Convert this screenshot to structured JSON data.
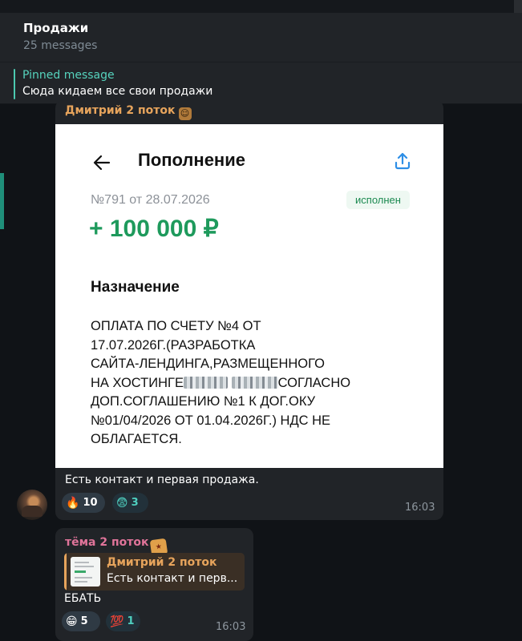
{
  "header": {
    "title": "Продажи",
    "subtitle": "25 messages"
  },
  "pinned": {
    "label": "Pinned message",
    "text": "Сюда кидаем все свои продажи"
  },
  "messages": [
    {
      "sender": "Дмитрий 2 поток",
      "receipt": {
        "title": "Пополнение",
        "number": "№791 от 28.07.2026",
        "status": "исполнен",
        "amount": "+ 100 000 ₽",
        "purpose_heading": "Назначение",
        "purpose_lines": [
          "ОПЛАТА ПО СЧЕТУ №4 ОТ",
          "17.07.2026Г.(РАЗРАБОТКА",
          "САЙТА-ЛЕНДИНГА,РАЗМЕЩЕННОГО",
          "НА ХОСТИНГЕ",
          "СОГЛАСНО",
          "ДОП.СОГЛАШЕНИЮ №1 К ДОГ.ОКУ",
          "№01/04/2026 ОТ 01.04.2026Г.) НДС НЕ",
          "ОБЛАГАЕТСЯ."
        ]
      },
      "caption": "Есть контакт и первая продажа.",
      "reactions": [
        {
          "emoji": "🔥",
          "count": "10"
        },
        {
          "emoji": "😨",
          "count": "3"
        }
      ],
      "time": "16:03"
    },
    {
      "sender": "тёма 2 поток",
      "reply": {
        "author": "Дмитрий 2 поток",
        "text": "Есть контакт и перв..."
      },
      "text": "ЕБАТЬ",
      "reactions": [
        {
          "emoji": "😁",
          "count": "5"
        },
        {
          "emoji": "💯",
          "count": "1"
        }
      ],
      "time": "16:03"
    }
  ],
  "colors": {
    "accent": "#56d3bd",
    "sender1": "#e7a45c",
    "sender2": "#e0749a",
    "amount_green": "#1e9a5c"
  },
  "icons": {
    "back": "back-arrow-icon",
    "share": "share-icon"
  }
}
